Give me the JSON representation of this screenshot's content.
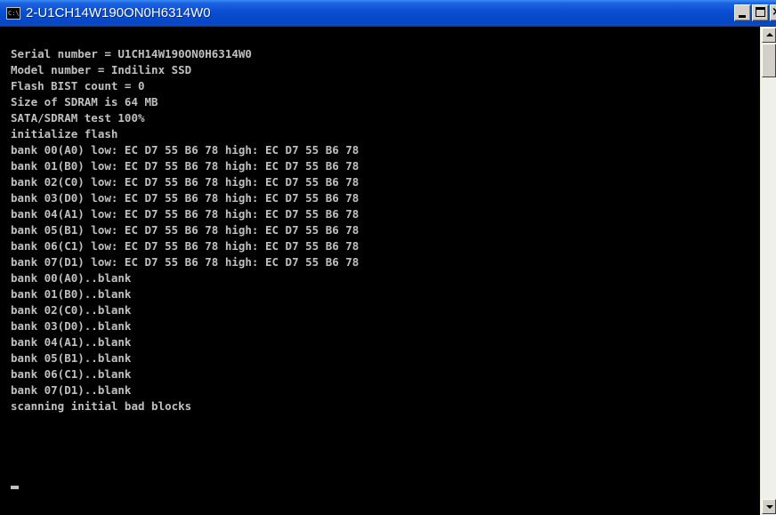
{
  "window": {
    "title": "2-U1CH14W190ON0H6314W0",
    "icon": "console-icon",
    "icon_glyph": "C:\\"
  },
  "controls": {
    "minimize_icon": "minimize-icon",
    "maximize_icon": "maximize-icon",
    "close_icon": "close-icon",
    "close_glyph": "×"
  },
  "console": {
    "lines": [
      "Serial number = U1CH14W190ON0H6314W0",
      "Model number = Indilinx SSD",
      "Flash BIST count = 0",
      "Size of SDRAM is 64 MB",
      "SATA/SDRAM test 100%",
      "initialize flash",
      "bank 00(A0) low: EC D7 55 B6 78 high: EC D7 55 B6 78",
      "bank 01(B0) low: EC D7 55 B6 78 high: EC D7 55 B6 78",
      "bank 02(C0) low: EC D7 55 B6 78 high: EC D7 55 B6 78",
      "bank 03(D0) low: EC D7 55 B6 78 high: EC D7 55 B6 78",
      "bank 04(A1) low: EC D7 55 B6 78 high: EC D7 55 B6 78",
      "bank 05(B1) low: EC D7 55 B6 78 high: EC D7 55 B6 78",
      "bank 06(C1) low: EC D7 55 B6 78 high: EC D7 55 B6 78",
      "bank 07(D1) low: EC D7 55 B6 78 high: EC D7 55 B6 78",
      "bank 00(A0)..blank",
      "bank 01(B0)..blank",
      "bank 02(C0)..blank",
      "bank 03(D0)..blank",
      "bank 04(A1)..blank",
      "bank 05(B1)..blank",
      "bank 06(C1)..blank",
      "bank 07(D1)..blank",
      "scanning initial bad blocks"
    ],
    "text_color": "#c0c0c0",
    "background_color": "#000000"
  },
  "scrollbar": {
    "up_icon": "scroll-up-arrow-icon",
    "down_icon": "scroll-down-arrow-icon"
  }
}
